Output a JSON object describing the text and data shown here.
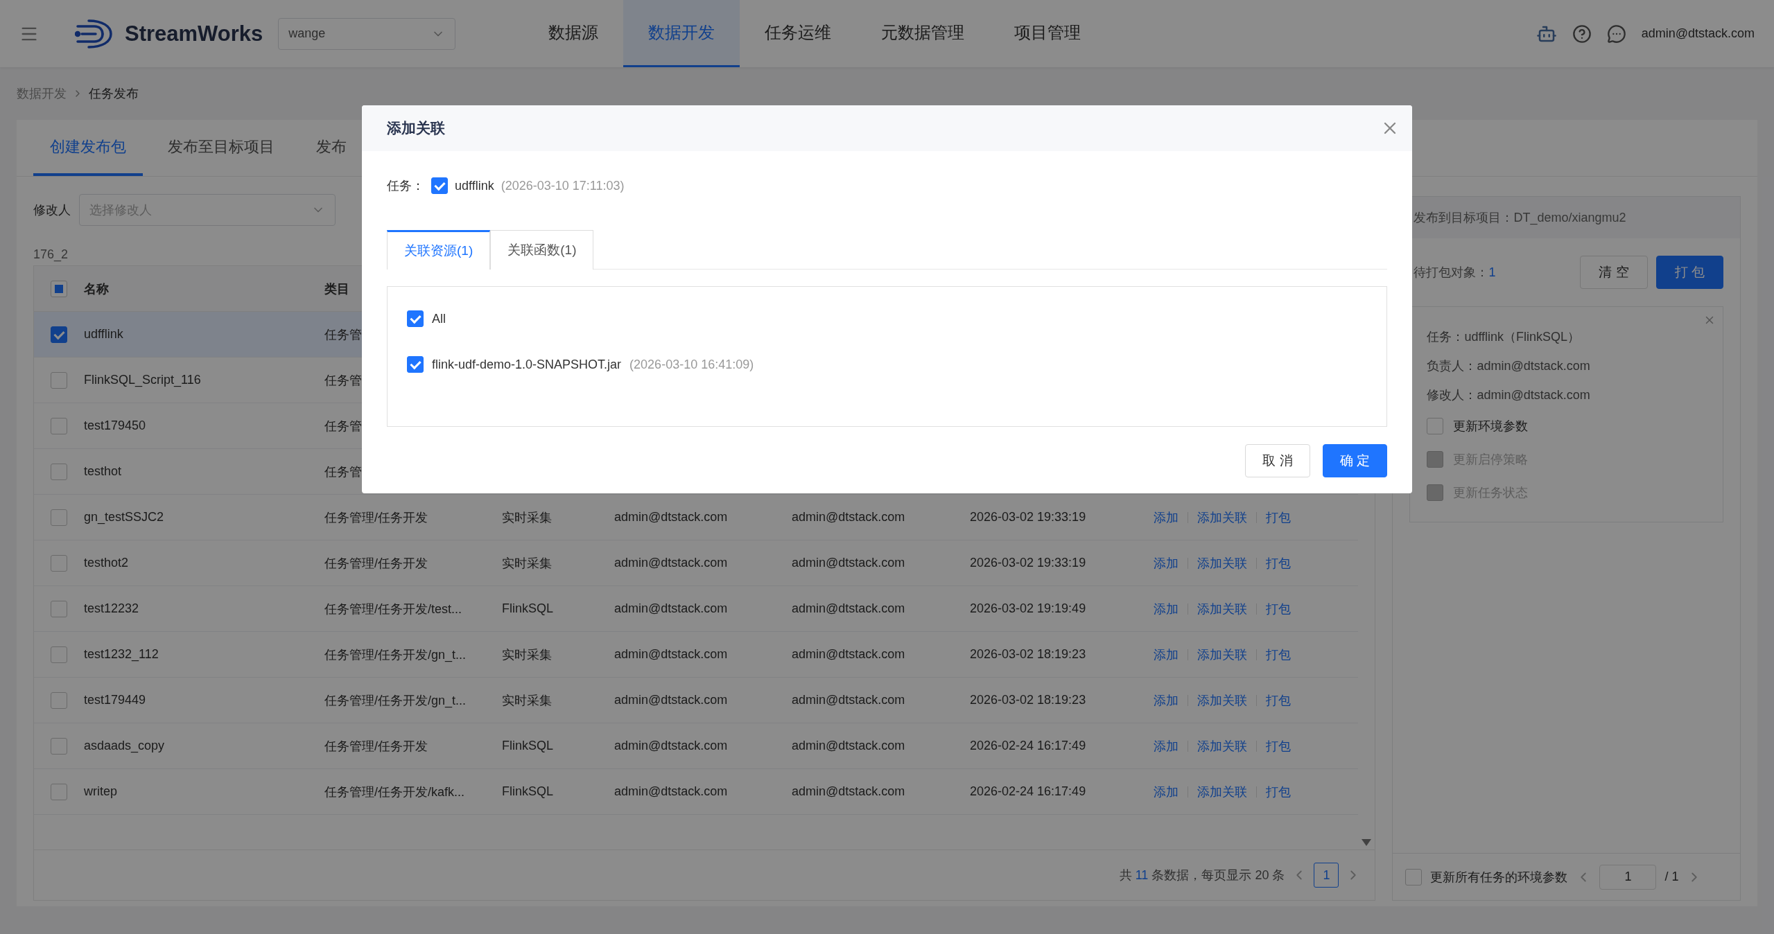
{
  "topbar": {
    "app_name": "StreamWorks",
    "project": "wange",
    "nav": [
      {
        "label": "数据源",
        "selected": false
      },
      {
        "label": "数据开发",
        "selected": true
      },
      {
        "label": "任务运维",
        "selected": false
      },
      {
        "label": "元数据管理",
        "selected": false
      },
      {
        "label": "项目管理",
        "selected": false
      }
    ],
    "user": "admin@dtstack.com"
  },
  "breadcrumb": [
    "数据开发",
    "任务发布"
  ],
  "page_tabs": [
    {
      "label": "创建发布包",
      "selected": true
    },
    {
      "label": "发布至目标项目",
      "selected": false
    },
    {
      "label": "发布",
      "selected": false
    }
  ],
  "filter": {
    "label": "修改人",
    "placeholder": "选择修改人"
  },
  "table": {
    "caption": "176_2",
    "select_all": {
      "indeterminate": true
    },
    "columns": [
      "名称",
      "类目"
    ],
    "rows": [
      {
        "name": "udfflink",
        "selected": true,
        "category": "任务管"
      },
      {
        "name": "FlinkSQL_Script_116",
        "selected": false,
        "category": "任务管"
      },
      {
        "name": "test179450",
        "selected": false,
        "category": "任务管"
      },
      {
        "name": "testhot",
        "selected": false,
        "category": "任务管"
      },
      {
        "name": "gn_testSSJC2",
        "selected": false,
        "category": "任务管理/任务开发",
        "type": "实时采集",
        "owner": "admin@dtstack.com",
        "modifier": "admin@dtstack.com",
        "time": "2026-03-02 19:33:19",
        "actions": [
          "添加",
          "添加关联",
          "打包"
        ]
      },
      {
        "name": "testhot2",
        "selected": false,
        "category": "任务管理/任务开发",
        "type": "实时采集",
        "owner": "admin@dtstack.com",
        "modifier": "admin@dtstack.com",
        "time": "2026-03-02 19:33:19",
        "actions": [
          "添加",
          "添加关联",
          "打包"
        ]
      },
      {
        "name": "test12232",
        "selected": false,
        "category": "任务管理/任务开发/test...",
        "type": "FlinkSQL",
        "owner": "admin@dtstack.com",
        "modifier": "admin@dtstack.com",
        "time": "2026-03-02 19:19:49",
        "actions": [
          "添加",
          "添加关联",
          "打包"
        ]
      },
      {
        "name": "test1232_112",
        "selected": false,
        "category": "任务管理/任务开发/gn_t...",
        "type": "实时采集",
        "owner": "admin@dtstack.com",
        "modifier": "admin@dtstack.com",
        "time": "2026-03-02 18:19:23",
        "actions": [
          "添加",
          "添加关联",
          "打包"
        ]
      },
      {
        "name": "test179449",
        "selected": false,
        "category": "任务管理/任务开发/gn_t...",
        "type": "实时采集",
        "owner": "admin@dtstack.com",
        "modifier": "admin@dtstack.com",
        "time": "2026-03-02 18:19:23",
        "actions": [
          "添加",
          "添加关联",
          "打包"
        ]
      },
      {
        "name": "asdaads_copy",
        "selected": false,
        "category": "任务管理/任务开发",
        "type": "FlinkSQL",
        "owner": "admin@dtstack.com",
        "modifier": "admin@dtstack.com",
        "time": "2026-02-24 16:17:49",
        "actions": [
          "添加",
          "添加关联",
          "打包"
        ]
      },
      {
        "name": "writep",
        "selected": false,
        "category": "任务管理/任务开发/kafk...",
        "type": "FlinkSQL",
        "owner": "admin@dtstack.com",
        "modifier": "admin@dtstack.com",
        "time": "2026-02-24 16:17:49",
        "actions": [
          "添加",
          "添加关联",
          "打包"
        ]
      }
    ]
  },
  "pagination": {
    "prefix": "共",
    "total": "11",
    "suffix": "条数据，每页显示 20 条",
    "pages": [
      {
        "label": "1",
        "selected": true
      }
    ]
  },
  "release_panel": {
    "target": "发布到目标项目：DT_demo/xiangmu2",
    "pending_label": "待打包对象：",
    "pending_count": "1",
    "buttons": [
      {
        "label": "清 空",
        "kind": "default"
      },
      {
        "label": "打 包",
        "kind": "primary"
      }
    ],
    "item": {
      "lines": [
        "任务：udfflink（FlinkSQL）",
        "负责人：admin@dtstack.com",
        "修改人：admin@dtstack.com"
      ],
      "options": [
        {
          "label": "更新环境参数",
          "checked": false,
          "disabled": false
        },
        {
          "label": "更新启停策略",
          "checked": false,
          "disabled": true
        },
        {
          "label": "更新任务状态",
          "checked": false,
          "disabled": true
        }
      ]
    },
    "footer": {
      "label": "更新所有任务的环境参数",
      "checked": false,
      "page": "1",
      "total_pages": "/ 1"
    }
  },
  "dialog": {
    "title": "添加关联",
    "task_label": "任务：",
    "task": {
      "name": "udfflink",
      "time": "(2026-03-10 17:11:03)",
      "checked": true
    },
    "tabs": [
      {
        "label": "关联资源(1)",
        "selected": true
      },
      {
        "label": "关联函数(1)",
        "selected": false
      }
    ],
    "resources": [
      {
        "name": "All",
        "checked": true
      },
      {
        "name": "flink-udf-demo-1.0-SNAPSHOT.jar",
        "time": "(2026-03-10 16:41:09)",
        "checked": true
      }
    ],
    "buttons": [
      {
        "label": "取 消",
        "kind": "default"
      },
      {
        "label": "确 定",
        "kind": "primary"
      }
    ]
  }
}
